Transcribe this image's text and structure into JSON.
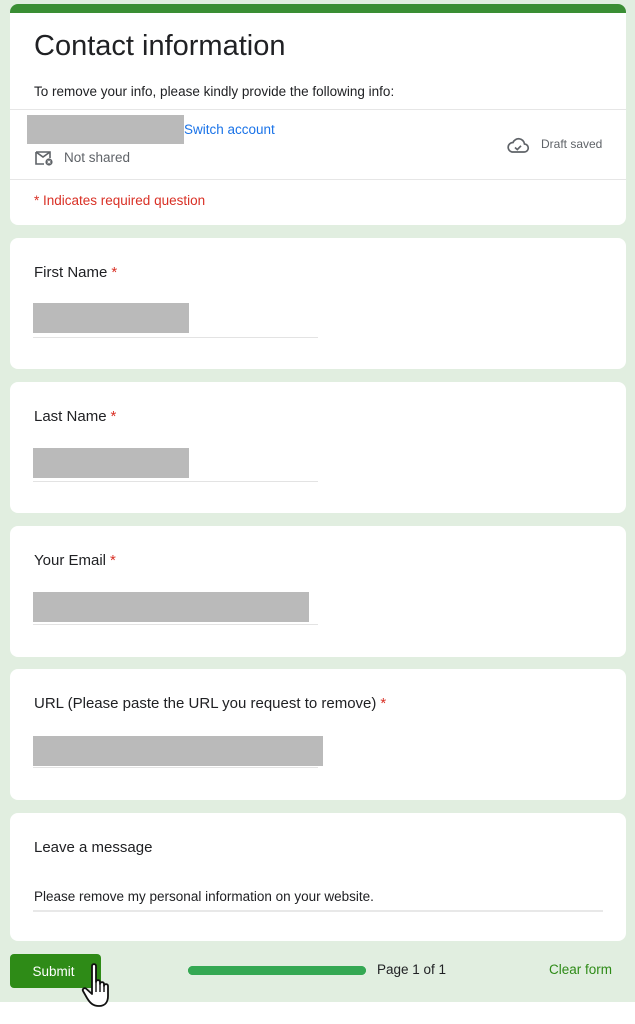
{
  "form": {
    "title": "Contact information",
    "description": "To remove your info, please kindly provide the following info:",
    "account": {
      "switch_label": "Switch account",
      "not_shared_label": "Not shared",
      "not_shared_icon": "mail-off-icon",
      "draft_status": "Draft saved",
      "draft_icon": "cloud-check-icon"
    },
    "required_note": "* Indicates required question",
    "questions": [
      {
        "label": "First Name",
        "required": "*",
        "value": ""
      },
      {
        "label": "Last Name",
        "required": "*",
        "value": ""
      },
      {
        "label": "Your Email",
        "required": "*",
        "value": ""
      },
      {
        "label": "URL (Please paste the URL you request to remove)",
        "required": "*",
        "value": ""
      },
      {
        "label": "Leave a message",
        "required": "",
        "value": "Please remove my personal information on your website."
      }
    ],
    "footer": {
      "submit_label": "Submit",
      "progress_percent": 100,
      "page_label": "Page 1 of 1",
      "clear_label": "Clear form"
    }
  },
  "colors": {
    "accent": "#3a8e34",
    "submit": "#2e8b17",
    "progress": "#34a853",
    "required": "#d93025",
    "link": "#1a73e8",
    "page_background": "#e1eee0"
  }
}
